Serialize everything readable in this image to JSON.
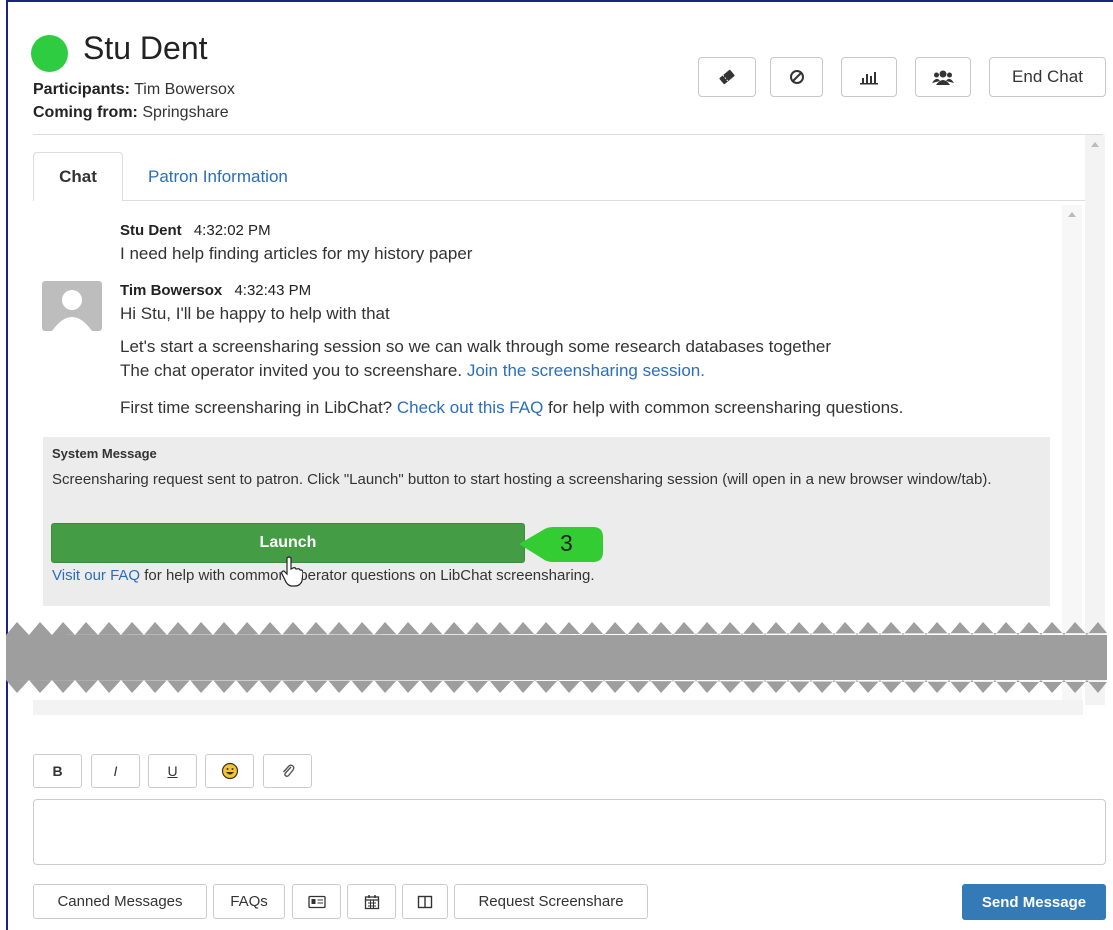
{
  "header": {
    "patron_name": "Stu Dent",
    "participants_label": "Participants:",
    "participants_value": "Tim Bowersox",
    "coming_from_label": "Coming from:",
    "coming_from_value": "Springshare",
    "status_color": "#2ecc40",
    "toolbar": {
      "ticket_icon": "ticket-icon",
      "block_icon": "ban-icon",
      "stats_icon": "bar-chart-icon",
      "users_icon": "users-icon",
      "end_chat_label": "End Chat"
    }
  },
  "tabs": [
    {
      "label": "Chat",
      "active": true
    },
    {
      "label": "Patron Information",
      "active": false
    }
  ],
  "messages": [
    {
      "sender": "Stu Dent",
      "time": "4:32:02 PM",
      "lines": [
        "I need help finding articles for my history paper"
      ]
    },
    {
      "sender": "Tim Bowersox",
      "time": "4:32:43 PM",
      "lines": [
        "Hi Stu, I'll be happy to help with that",
        "Let's start a screensharing session so we can walk through some research databases together"
      ]
    }
  ],
  "screenshare_invite": {
    "text": "The chat operator invited you to screenshare.",
    "link": "Join the screensharing session."
  },
  "faq_hint": {
    "prefix": "First time screensharing in LibChat?",
    "link": "Check out this FAQ",
    "suffix": "for help with common screensharing questions."
  },
  "system_message": {
    "title": "System Message",
    "text": "Screensharing request sent to patron. Click \"Launch\" button to start hosting a screensharing session (will open in a new browser window/tab).",
    "launch_label": "Launch",
    "faq_link": "Visit our FAQ",
    "faq_text": "for help with common operator questions on LibChat screensharing."
  },
  "callout_number": "3",
  "editor": {
    "bold": "B",
    "italic": "I",
    "underline": "U",
    "emoji_icon": "emoji-icon",
    "attach_icon": "paperclip-icon",
    "message_value": ""
  },
  "bottom_bar": {
    "canned": "Canned Messages",
    "faqs": "FAQs",
    "contact_icon": "contact-card-icon",
    "calendar_icon": "calendar-icon",
    "columns_icon": "columns-icon",
    "request_screenshare": "Request Screenshare",
    "send": "Send Message"
  },
  "colors": {
    "accent": "#337ab7",
    "launch": "#449d44",
    "callout": "#33cc33",
    "link": "#2a6ebb"
  }
}
